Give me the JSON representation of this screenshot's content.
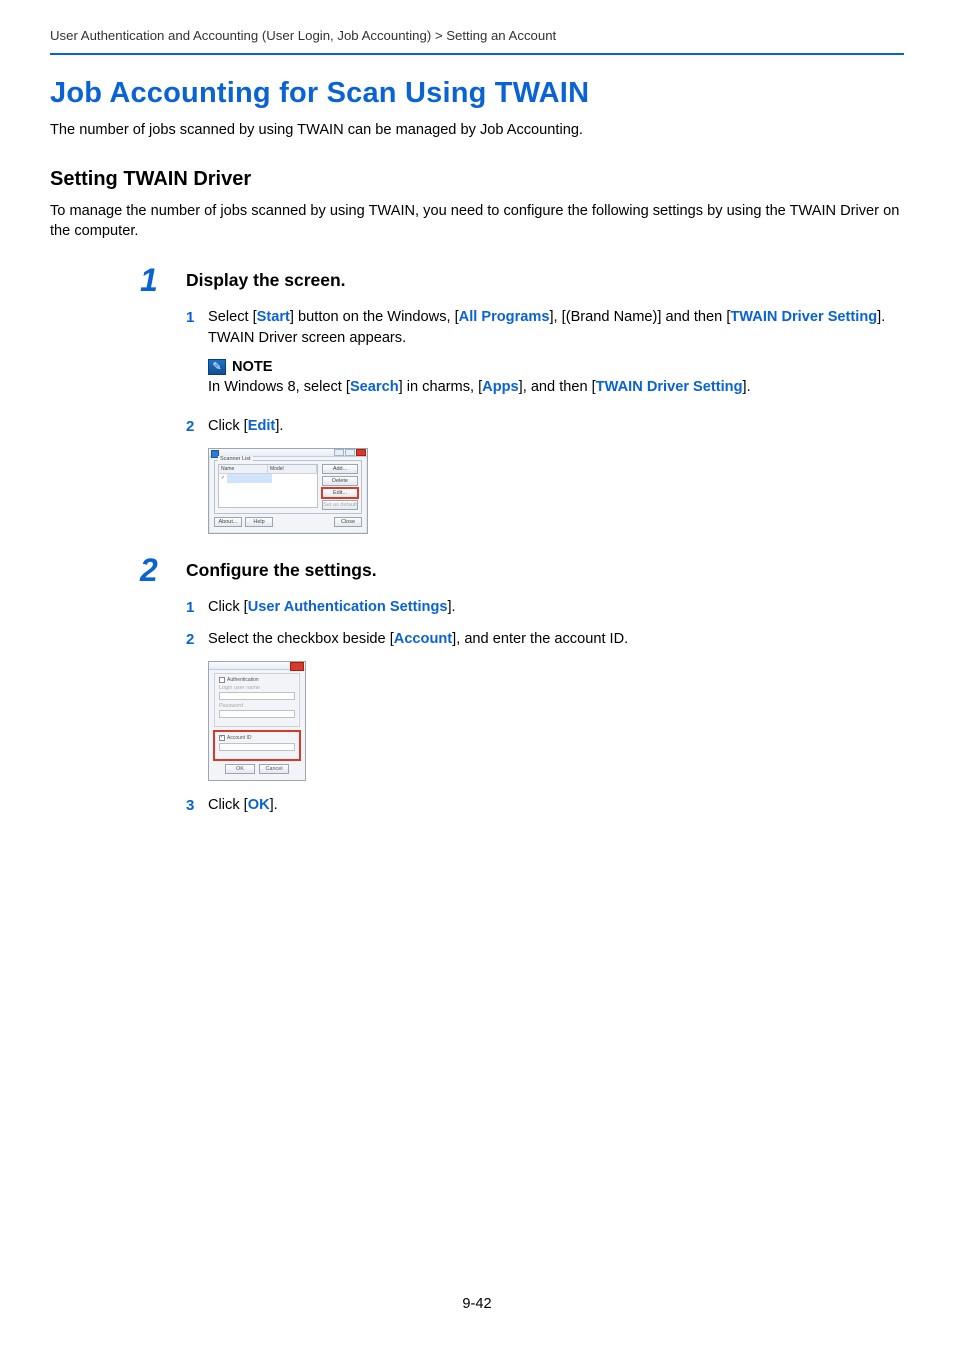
{
  "breadcrumb": "User Authentication and Accounting (User Login, Job Accounting) > Setting an Account",
  "h1": "Job Accounting for Scan Using TWAIN",
  "intro": "The number of jobs scanned by using TWAIN can be managed by Job Accounting.",
  "h2": "Setting TWAIN Driver",
  "para": "To manage the number of jobs scanned by using TWAIN, you need to configure the following settings by using the TWAIN Driver on the computer.",
  "step1": {
    "num": "1",
    "title": "Display the screen.",
    "sub1": {
      "n": "1",
      "pre": "Select [",
      "l1": "Start",
      "mid1": "] button on the Windows, [",
      "l2": "All Programs",
      "mid2": "], [(Brand Name)] and then [",
      "l3": "TWAIN Driver Setting",
      "post": "]. TWAIN Driver screen appears."
    },
    "note": {
      "title": "NOTE",
      "pre": "In Windows 8, select [",
      "l1": "Search",
      "mid1": "] in charms, [",
      "l2": "Apps",
      "mid2": "], and then [",
      "l3": "TWAIN Driver Setting",
      "post": "]."
    },
    "sub2": {
      "n": "2",
      "pre": "Click [",
      "l1": "Edit",
      "post": "]."
    }
  },
  "shot1": {
    "group": "Scanner List",
    "col_name": "Name",
    "col_model": "Model",
    "btn_add": "Add...",
    "btn_delete": "Delete",
    "btn_edit": "Edit...",
    "btn_default": "Set as default",
    "btn_about": "About...",
    "btn_help": "Help",
    "btn_close": "Close"
  },
  "step2": {
    "num": "2",
    "title": "Configure the settings.",
    "sub1": {
      "n": "1",
      "pre": "Click [",
      "l1": "User Authentication Settings",
      "post": "]."
    },
    "sub2": {
      "n": "2",
      "pre": "Select the checkbox beside [",
      "l1": "Account",
      "post": "], and enter the account ID."
    },
    "sub3": {
      "n": "3",
      "pre": "Click [",
      "l1": "OK",
      "post": "]."
    }
  },
  "shot2": {
    "auth_label": "Authentication",
    "login_label": "Login user name",
    "pwd_label": "Password",
    "account_label": "Account ID",
    "btn_ok": "OK",
    "btn_cancel": "Cancel"
  },
  "page_num": "9-42"
}
